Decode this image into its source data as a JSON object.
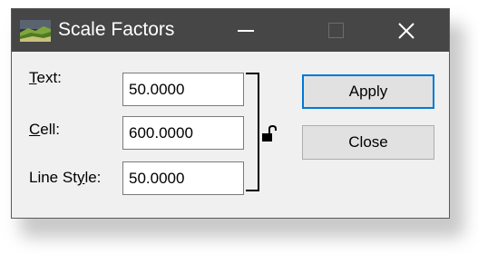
{
  "window": {
    "title": "Scale Factors"
  },
  "titlebar": {
    "icons": [
      "app-icon",
      "minimize-icon",
      "maximize-icon",
      "close-icon"
    ]
  },
  "labels": {
    "text": {
      "accel": "T",
      "rest": "ext:"
    },
    "cell": {
      "accel": "C",
      "rest": "ell:"
    },
    "line_style": {
      "before": "Line St",
      "accel": "y",
      "after": "le:"
    }
  },
  "fields": {
    "text": "50.0000",
    "cell": "600.0000",
    "line_style": "50.0000"
  },
  "lock": {
    "icon": "unlocked-padlock-icon",
    "state": "unlocked"
  },
  "buttons": {
    "apply": "Apply",
    "close": "Close"
  },
  "colors": {
    "titlebar": "#464646",
    "dialog_background": "#f0f0f0",
    "default_button_border": "#0078d7"
  }
}
